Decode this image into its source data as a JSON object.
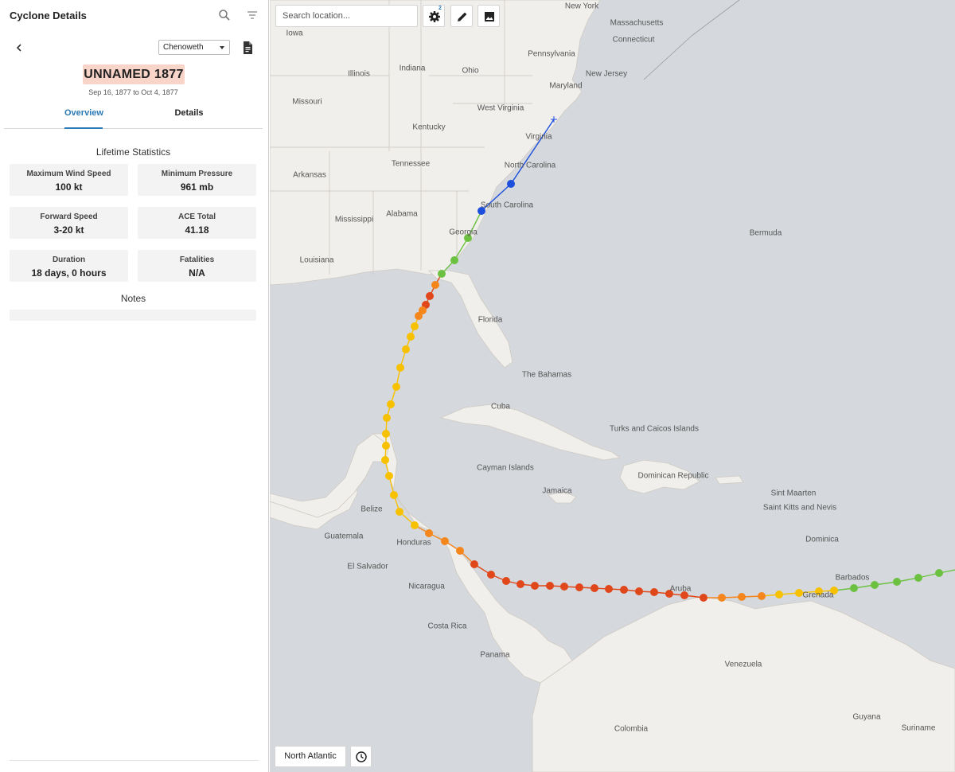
{
  "sidebar": {
    "title": "Cyclone Details",
    "source": "Chenoweth",
    "storm_name": "UNNAMED 1877",
    "dates": "Sep 16, 1877 to Oct 4, 1877",
    "tabs": [
      {
        "label": "Overview",
        "active": true
      },
      {
        "label": "Details",
        "active": false
      }
    ],
    "lifetime_title": "Lifetime Statistics",
    "stats": [
      {
        "label": "Maximum Wind Speed",
        "value": "100 kt"
      },
      {
        "label": "Minimum Pressure",
        "value": "961 mb"
      },
      {
        "label": "Forward Speed",
        "value": "3-20 kt"
      },
      {
        "label": "ACE Total",
        "value": "41.18"
      },
      {
        "label": "Duration",
        "value": "18 days, 0 hours"
      },
      {
        "label": "Fatalities",
        "value": "N/A"
      }
    ],
    "notes_title": "Notes",
    "accent_color": "#2b7ab5",
    "name_bg_color": "#f9d4c8"
  },
  "map": {
    "search_placeholder": "Search location...",
    "settings_badge": "2",
    "basin_label": "North Atlantic",
    "toolbar_icons": [
      "gear-icon",
      "pencil-icon",
      "image-icon",
      "clock-icon"
    ],
    "labels": [
      "New York",
      "Massachusetts",
      "Connecticut",
      "Iowa",
      "Pennsylvania",
      "New Jersey",
      "Maryland",
      "Indiana",
      "Ohio",
      "Illinois",
      "Missouri",
      "West Virginia",
      "Kentucky",
      "Virginia",
      "Tennessee",
      "North Carolina",
      "Arkansas",
      "South Carolina",
      "Alabama",
      "Mississippi",
      "Georgia",
      "Bermuda",
      "Louisiana",
      "Florida",
      "The Bahamas",
      "Cuba",
      "Turks and Caicos Islands",
      "Cayman Islands",
      "Dominican Republic",
      "Jamaica",
      "Sint Maarten",
      "Saint Kitts and Nevis",
      "Belize",
      "Guatemala",
      "Honduras",
      "Dominica",
      "El Salvador",
      "Barbados",
      "Nicaragua",
      "Aruba",
      "Grenada",
      "Costa Rica",
      "Panama",
      "Venezuela",
      "Colombia",
      "Guyana",
      "Suriname"
    ],
    "intensity_colors": {
      "tropical_depression": "#1d4fdc",
      "tropical_storm": "#6cc240",
      "category_1": "#f7c100",
      "category_2": "#f4861c",
      "category_3": "#e0471a"
    }
  }
}
